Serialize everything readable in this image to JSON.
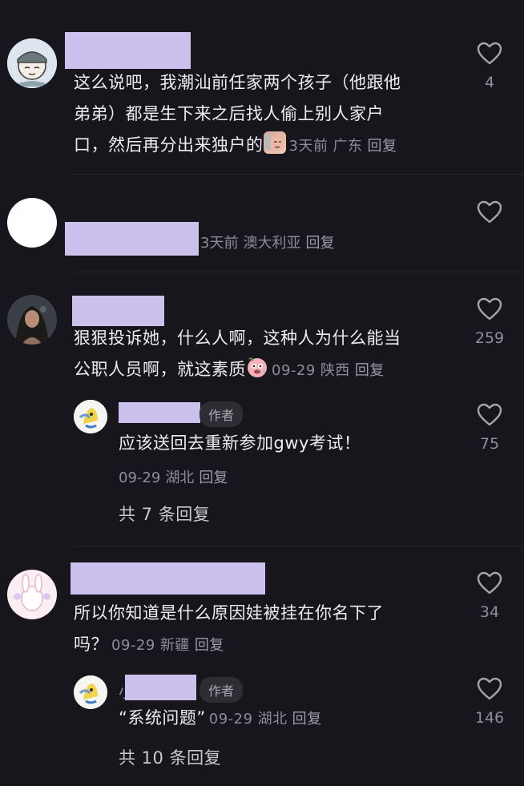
{
  "comments": [
    {
      "text_lines": [
        "这么说吧，我潮汕前任家两个孩子（他跟他",
        "弟弟）都是生下来之后找人偷上别人家户",
        "口，然后再分出来独户的"
      ],
      "emoji": "smirk-face-emoji",
      "time": "3天前",
      "location": "广东",
      "reply_label": "回复",
      "likes": "4"
    },
    {
      "time": "3天前",
      "location": "澳大利亚",
      "reply_label": "回复",
      "likes": ""
    },
    {
      "text_lines": [
        "狠狠投诉她，什么人啊，这种人为什么能当",
        "公职人员啊，就这素质"
      ],
      "emoji": "sweating-face-emoji",
      "time": "09-29",
      "location": "陕西",
      "reply_label": "回复",
      "likes": "259",
      "reply": {
        "badge": "作者",
        "text": "应该送回去重新参加gwy考试！",
        "time": "09-29",
        "location": "湖北",
        "reply_label": "回复",
        "likes": "75"
      },
      "more_replies": "共 7 条回复"
    },
    {
      "text_lines": [
        "所以你知道是什么原因娃被挂在你名下了",
        "吗？"
      ],
      "time": "09-29",
      "location": "新疆",
      "reply_label": "回复",
      "likes": "34",
      "reply": {
        "name_prefix": "小",
        "badge": "作者",
        "text": "“系统问题”",
        "time": "09-29",
        "location": "湖北",
        "reply_label": "回复",
        "likes": "146"
      },
      "more_replies": "共 10 条回复"
    }
  ],
  "colors": {
    "background": "#16161c",
    "name_redaction": "#cbc1ec",
    "meta": "#8d8d96"
  }
}
